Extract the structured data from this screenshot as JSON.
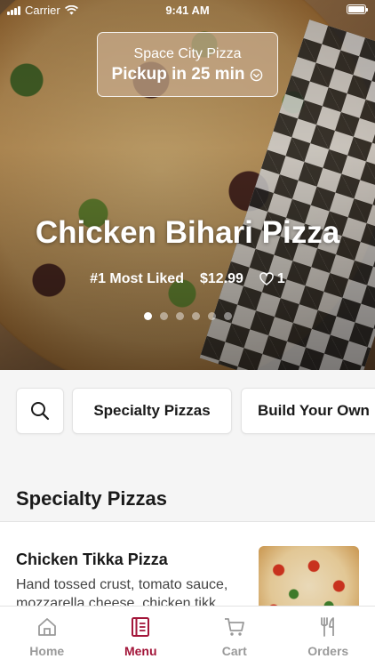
{
  "status_bar": {
    "carrier": "Carrier",
    "time": "9:41 AM"
  },
  "pickup": {
    "store": "Space City Pizza",
    "time_label": "Pickup in 25 min"
  },
  "hero": {
    "title": "Chicken Bihari Pizza",
    "badge": "#1 Most Liked",
    "price": "$12.99",
    "likes": "1",
    "carousel": {
      "count": 6,
      "active_index": 0
    }
  },
  "categories": [
    {
      "label": "Specialty Pizzas"
    },
    {
      "label": "Build Your Own"
    }
  ],
  "section": {
    "title": "Specialty Pizzas",
    "items": [
      {
        "name": "Chicken Tikka Pizza",
        "description": "Hand tossed crust, tomato sauce, mozzarella cheese, chicken tikk..."
      }
    ]
  },
  "tabs": [
    {
      "label": "Home",
      "icon": "home-icon",
      "active": false
    },
    {
      "label": "Menu",
      "icon": "menu-icon",
      "active": true
    },
    {
      "label": "Cart",
      "icon": "cart-icon",
      "active": false
    },
    {
      "label": "Orders",
      "icon": "orders-icon",
      "active": false
    }
  ],
  "colors": {
    "accent": "#a3163a",
    "inactive": "#9a9a9a"
  }
}
